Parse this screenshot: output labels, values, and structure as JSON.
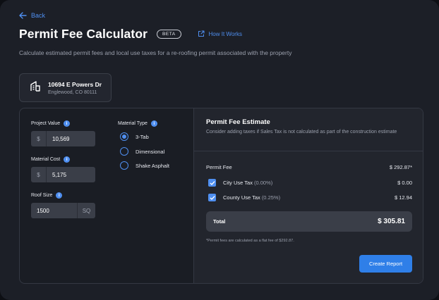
{
  "nav": {
    "back_label": "Back"
  },
  "header": {
    "title": "Permit Fee Calculator",
    "badge": "BETA",
    "how_it_works": "How It Works",
    "subtitle": "Calculate estimated permit fees and local use taxes for a re-roofing permit associated with the property"
  },
  "address": {
    "street": "10694 E Powers Dr",
    "city": "Englewood, CO 80111"
  },
  "form": {
    "project_value": {
      "label": "Project Value",
      "prefix": "$",
      "value": "10,569"
    },
    "material_cost": {
      "label": "Material Cost",
      "prefix": "$",
      "value": "5,175"
    },
    "roof_size": {
      "label": "Roof Size",
      "value": "1500",
      "suffix": "SQ"
    },
    "material_type": {
      "label": "Material Type",
      "options": [
        "3-Tab",
        "Dimensional",
        "Shake Asphalt"
      ],
      "selected": "3-Tab"
    },
    "info_glyph": "i"
  },
  "estimate": {
    "title": "Permit Fee Estimate",
    "subtitle": "Consider adding taxes if Sales Tax is not calculated as part of the construction estimate",
    "permit_fee_label": "Permit Fee",
    "permit_fee_amount": "$ 292.87*",
    "city_tax_label": "City Use Tax",
    "city_tax_rate": "(0.00%)",
    "city_tax_amount": "$ 0.00",
    "county_tax_label": "County Use Tax",
    "county_tax_rate": "(0.25%)",
    "county_tax_amount": "$ 12.94",
    "total_label": "Total",
    "total_amount": "$ 305.81",
    "footnote": "*Permit fees are calculated as a flat fee of $292.87.",
    "create_report": "Create Report"
  },
  "colors": {
    "accent": "#4f8ff0",
    "button": "#2f7fe8",
    "background": "#1c1f27"
  }
}
